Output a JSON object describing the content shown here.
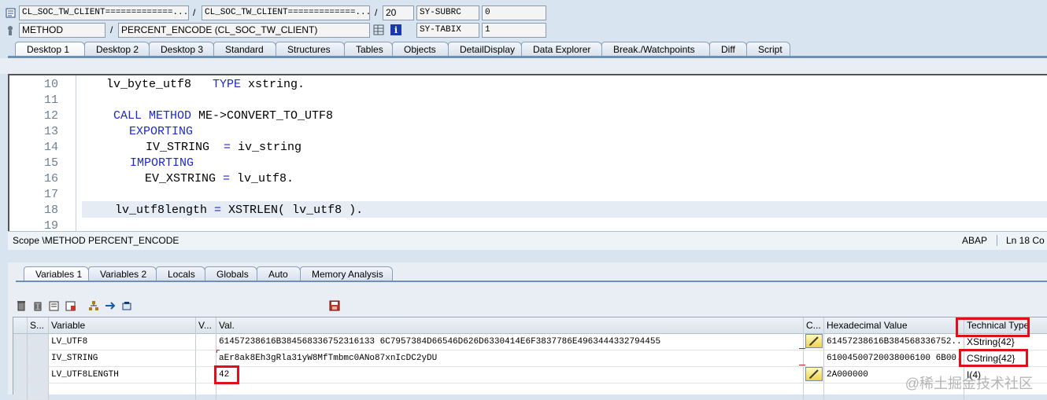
{
  "header": {
    "row1": {
      "program": "CL_SOC_TW_CLIENT=============...",
      "include": "CL_SOC_TW_CLIENT=============...",
      "line": "20",
      "sysfield_name": "SY-SUBRC",
      "sysfield_value": "0"
    },
    "row2": {
      "event_type": "METHOD",
      "event": "PERCENT_ENCODE (CL_SOC_TW_CLIENT)",
      "sysfield_name": "SY-TABIX",
      "sysfield_value": "1"
    },
    "slash": "/"
  },
  "main_tabs": [
    "Desktop 1",
    "Desktop 2",
    "Desktop 3",
    "Standard",
    "Structures",
    "Tables",
    "Objects",
    "DetailDisplay",
    "Data Explorer",
    "Break./Watchpoints",
    "Diff",
    "Script"
  ],
  "editor": {
    "lines": [
      {
        "num": "10",
        "code": "    lv_byte_utf8   TYPE xstring."
      },
      {
        "num": "11",
        "code": ""
      },
      {
        "num": "12",
        "code": "     CALL METHOD ME->CONVERT_TO_UTF8"
      },
      {
        "num": "13",
        "code": "       EXPORTING"
      },
      {
        "num": "14",
        "code": "         IV_STRING  = iv_string"
      },
      {
        "num": "15",
        "code": "       IMPORTING"
      },
      {
        "num": "16",
        "code": "         EV_XSTRING = lv_utf8."
      },
      {
        "num": "17",
        "code": ""
      },
      {
        "num": "18",
        "code": "     lv_utf8length = XSTRLEN( lv_utf8 )."
      },
      {
        "num": "19",
        "code": ""
      }
    ]
  },
  "status": {
    "scope": "Scope \\METHOD PERCENT_ENCODE",
    "language": "ABAP",
    "position": "Ln  18 Co"
  },
  "var_tabs": [
    "Variables 1",
    "Variables 2",
    "Locals",
    "Globals",
    "Auto",
    "Memory Analysis"
  ],
  "grid": {
    "headers": {
      "s": "S...",
      "variable": "Variable",
      "v": "V...",
      "val": "Val.",
      "c": "C...",
      "hex": "Hexadecimal Value",
      "type": "Technical Type"
    },
    "rows": [
      {
        "variable": "LV_UTF8",
        "val": "61457238616B384568336752316133 6C7957384D66546D626D6330414E6F3837786E4963444332794455",
        "hex": "61457238616B384568336752...",
        "type": "XString{42}"
      },
      {
        "variable": "IV_STRING",
        "val": "aEr8ak8Eh3gRla31yW8MfTmbmc0ANo87xnIcDC2yDU",
        "hex": "61004500720038006100 6B00...",
        "type": "CString{42}"
      },
      {
        "variable": "LV_UTF8LENGTH",
        "val": "42",
        "hex": "2A000000",
        "type": "I(4)"
      }
    ]
  },
  "watermark": "@稀土掘金技术社区"
}
